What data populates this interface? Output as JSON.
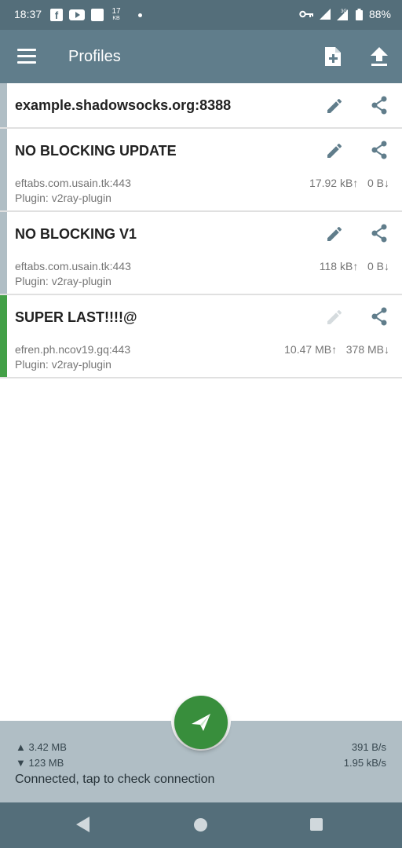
{
  "status_bar": {
    "time": "18:37",
    "facebook_glyph": "f",
    "net_speed_value": "17",
    "net_speed_unit": "KB",
    "battery": "88%",
    "icons": [
      "facebook-icon",
      "youtube-icon",
      "app-icon",
      "vpn-key-icon",
      "signal-icon",
      "signal-3g-icon",
      "battery-icon"
    ]
  },
  "app_bar": {
    "title": "Profiles",
    "icons": [
      "menu-icon",
      "add-profile-icon",
      "upload-icon"
    ]
  },
  "profiles": [
    {
      "name": "example.shadowsocks.org:8388",
      "server": "",
      "plugin": "",
      "tx": "",
      "rx": "",
      "active": false
    },
    {
      "name": "NO BLOCKING UPDATE",
      "server": "eftabs.com.usain.tk:443",
      "plugin": "Plugin: v2ray-plugin",
      "tx": "17.92 kB↑",
      "rx": "0 B↓",
      "active": false
    },
    {
      "name": "NO BLOCKING V1",
      "server": "eftabs.com.usain.tk:443",
      "plugin": "Plugin: v2ray-plugin",
      "tx": "118 kB↑",
      "rx": "0 B↓",
      "active": false
    },
    {
      "name": "SUPER LAST!!!!@",
      "server": "efren.ph.ncov19.gq:443",
      "plugin": "Plugin: v2ray-plugin",
      "tx": "10.47 MB↑",
      "rx": "378 MB↓",
      "active": true
    }
  ],
  "bottom_panel": {
    "tx_total": "▲ 3.42 MB",
    "rx_total": "▼ 123 MB",
    "tx_rate": "391 B/s",
    "rx_rate": "1.95 kB/s",
    "status": "Connected, tap to check connection"
  },
  "colors": {
    "status_bar": "#546e7a",
    "app_bar": "#607d8b",
    "active_indicator": "#43a047",
    "inactive_indicator": "#b0bec5",
    "fab": "#388e3c",
    "bottom_panel": "#b0bec5"
  }
}
